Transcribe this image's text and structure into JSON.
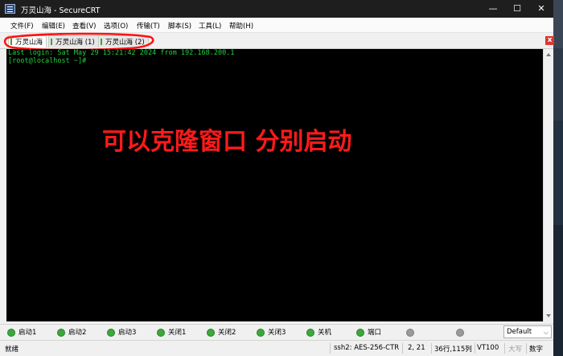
{
  "window": {
    "title": "万灵山海 - SecureCRT",
    "buttons": {
      "minimize": "—",
      "maximize": "☐",
      "close": "✕"
    }
  },
  "menu": [
    "文件(F)",
    "编辑(E)",
    "查看(V)",
    "选项(O)",
    "传输(T)",
    "脚本(S)",
    "工具(L)",
    "帮助(H)"
  ],
  "tabs": [
    {
      "label": "万灵山海",
      "active": true
    },
    {
      "label": "万灵山海 (1)",
      "active": false
    },
    {
      "label": "万灵山海 (2)",
      "active": false
    }
  ],
  "tab_close": "x",
  "terminal": {
    "lines": [
      "Last login: Sat May 29 15:21:42 2024 from 192.168.200.1",
      "[root@localhost ~]#"
    ],
    "annotation": "可以克隆窗口 分别启动"
  },
  "button_bar": {
    "buttons": [
      "启动1",
      "启动2",
      "启动3",
      "关闭1",
      "关闭2",
      "关闭3",
      "关机",
      "端口",
      "",
      ""
    ],
    "select_value": "Default"
  },
  "status": {
    "left": "就绪",
    "protocol": "ssh2: AES-256-CTR",
    "cursor": "2,  21",
    "size": "36行,115列",
    "emulation": "VT100",
    "caps": "大写",
    "num": "数字"
  },
  "colors": {
    "terminal_fg": "#1fd43d",
    "annotation": "#ff1a1a",
    "terminal_bg": "#000000"
  }
}
